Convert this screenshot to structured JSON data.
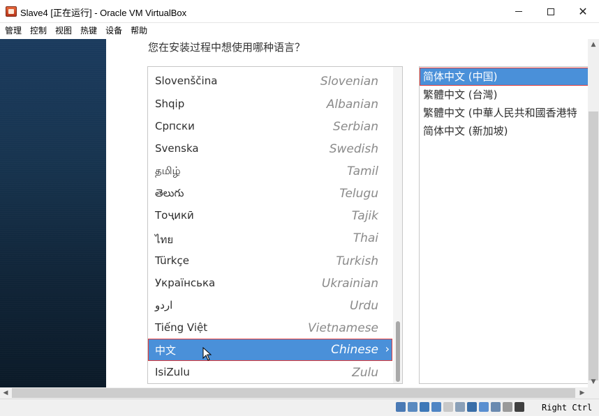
{
  "window": {
    "title": "Slave4 [正在运行] - Oracle VM VirtualBox",
    "min_glyph": "",
    "close_glyph": "✕"
  },
  "menu": [
    "管理",
    "控制",
    "视图",
    "热键",
    "设备",
    "帮助"
  ],
  "installer": {
    "question": "您在安装过程中想使用哪种语言？",
    "languages": [
      {
        "native": "Slovenščina",
        "english": "Slovenian"
      },
      {
        "native": "Shqip",
        "english": "Albanian"
      },
      {
        "native": "Српски",
        "english": "Serbian"
      },
      {
        "native": "Svenska",
        "english": "Swedish"
      },
      {
        "native": "தமிழ்",
        "english": "Tamil"
      },
      {
        "native": "తెలుగు",
        "english": "Telugu"
      },
      {
        "native": "Тоҷикӣ",
        "english": "Tajik"
      },
      {
        "native": "ไทย",
        "english": "Thai"
      },
      {
        "native": "Türkçe",
        "english": "Turkish"
      },
      {
        "native": "Українська",
        "english": "Ukrainian"
      },
      {
        "native": "اردو",
        "english": "Urdu"
      },
      {
        "native": "Tiếng Việt",
        "english": "Vietnamese"
      },
      {
        "native": "中文",
        "english": "Chinese",
        "selected": true
      },
      {
        "native": "IsiZulu",
        "english": "Zulu"
      }
    ],
    "selected_arrow": "›",
    "locales": [
      {
        "label": "简体中文 (中国)",
        "selected": true
      },
      {
        "label": "繁體中文 (台灣)"
      },
      {
        "label": "繁體中文 (中華人民共和國香港特"
      },
      {
        "label": "简体中文 (新加坡)"
      }
    ]
  },
  "scrollbars": {
    "up": "▲",
    "down": "▼",
    "left": "◀",
    "right": "▶"
  },
  "statusbar": {
    "host_key": "Right Ctrl",
    "icons": [
      "hard-disk-icon",
      "optical-drive-icon",
      "audio-icon",
      "network-icon",
      "usb-icon",
      "shared-folders-icon",
      "display-icon",
      "video-capture-icon",
      "virtualization-icon",
      "mouse-integration-icon",
      "keyboard-capture-icon"
    ]
  },
  "colors": {
    "selection": "#4a90d9",
    "highlight_border": "#e03a3a",
    "sidebar_top": "#1b3b5e",
    "sidebar_bottom": "#0b1a28"
  }
}
